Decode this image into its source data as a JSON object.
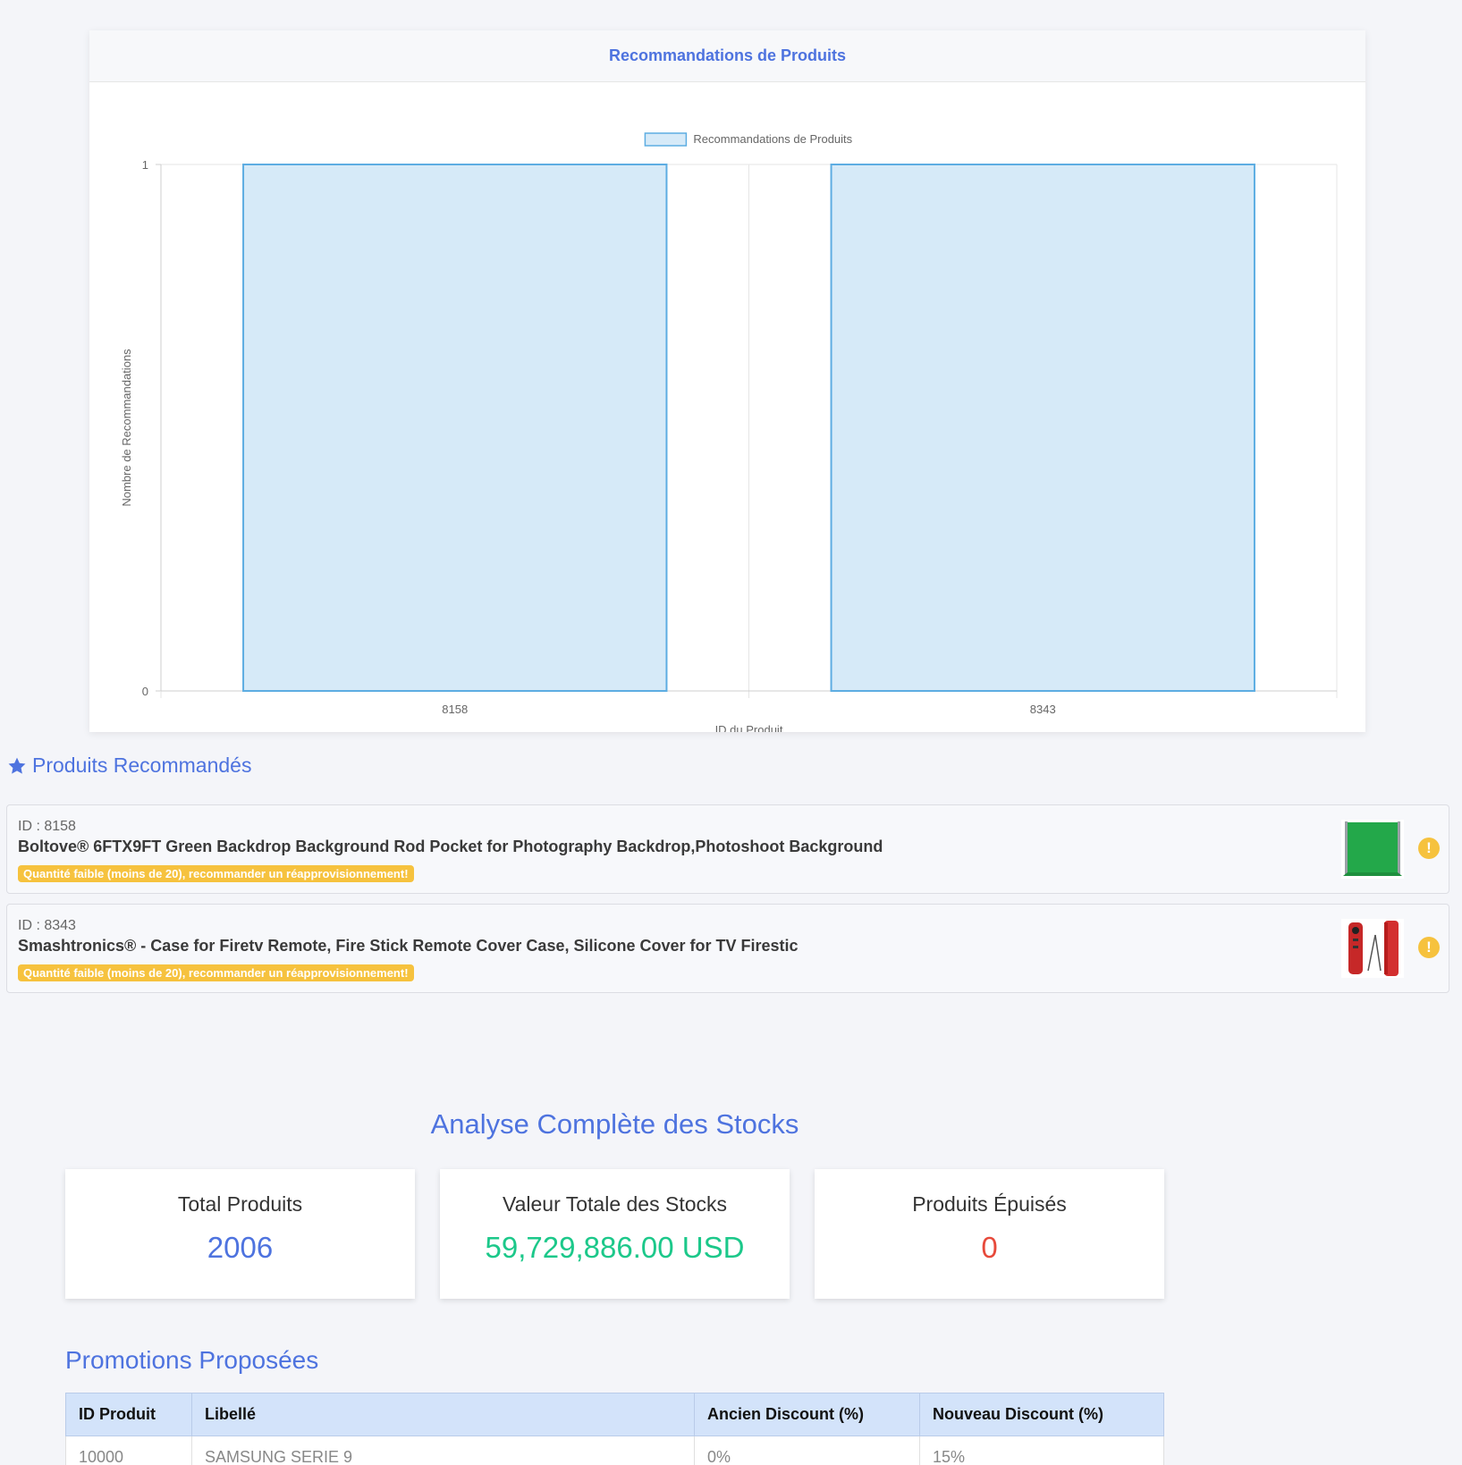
{
  "chart_card": {
    "header": "Recommandations de Produits"
  },
  "chart_data": {
    "type": "bar",
    "categories": [
      "8158",
      "8343"
    ],
    "series": [
      {
        "name": "Recommandations de Produits",
        "values": [
          1,
          1
        ]
      }
    ],
    "xlabel": "ID du Produit",
    "ylabel": "Nombre de Recommandations",
    "ylim": [
      0,
      1
    ],
    "yticks": [
      "0",
      "1"
    ],
    "legend": "top-center",
    "colors": {
      "fill": "#d6eaf8",
      "stroke": "#5dade2"
    }
  },
  "recommended": {
    "title": "Produits Recommandés",
    "items": [
      {
        "id_label": "ID : 8158",
        "title": "Boltove® 6FTX9FT Green Backdrop Background Rod Pocket for Photography Backdrop,Photoshoot Background",
        "badge": "Quantité faible (moins de 20), recommander un réapprovisionnement!",
        "thumb": "green-backdrop-image"
      },
      {
        "id_label": "ID : 8343",
        "title": "Smashtronics® - Case for Firetv Remote, Fire Stick Remote Cover Case, Silicone Cover for TV Firestic",
        "badge": "Quantité faible (moins de 20), recommander un réapprovisionnement!",
        "thumb": "red-remote-case-image"
      }
    ]
  },
  "stocks": {
    "title": "Analyse Complète des Stocks",
    "cards": [
      {
        "label": "Total Produits",
        "value": "2006",
        "color": "#4e73df"
      },
      {
        "label": "Valeur Totale des Stocks",
        "value": "59,729,886.00 USD",
        "color": "#1cc88a"
      },
      {
        "label": "Produits Épuisés",
        "value": "0",
        "color": "#e74a3b"
      }
    ]
  },
  "promotions": {
    "title": "Promotions Proposées",
    "headers": [
      "ID Produit",
      "Libellé",
      "Ancien Discount (%)",
      "Nouveau Discount (%)"
    ],
    "rows": [
      [
        "10000",
        "SAMSUNG SERIE 9",
        "0%",
        "15%"
      ]
    ]
  }
}
